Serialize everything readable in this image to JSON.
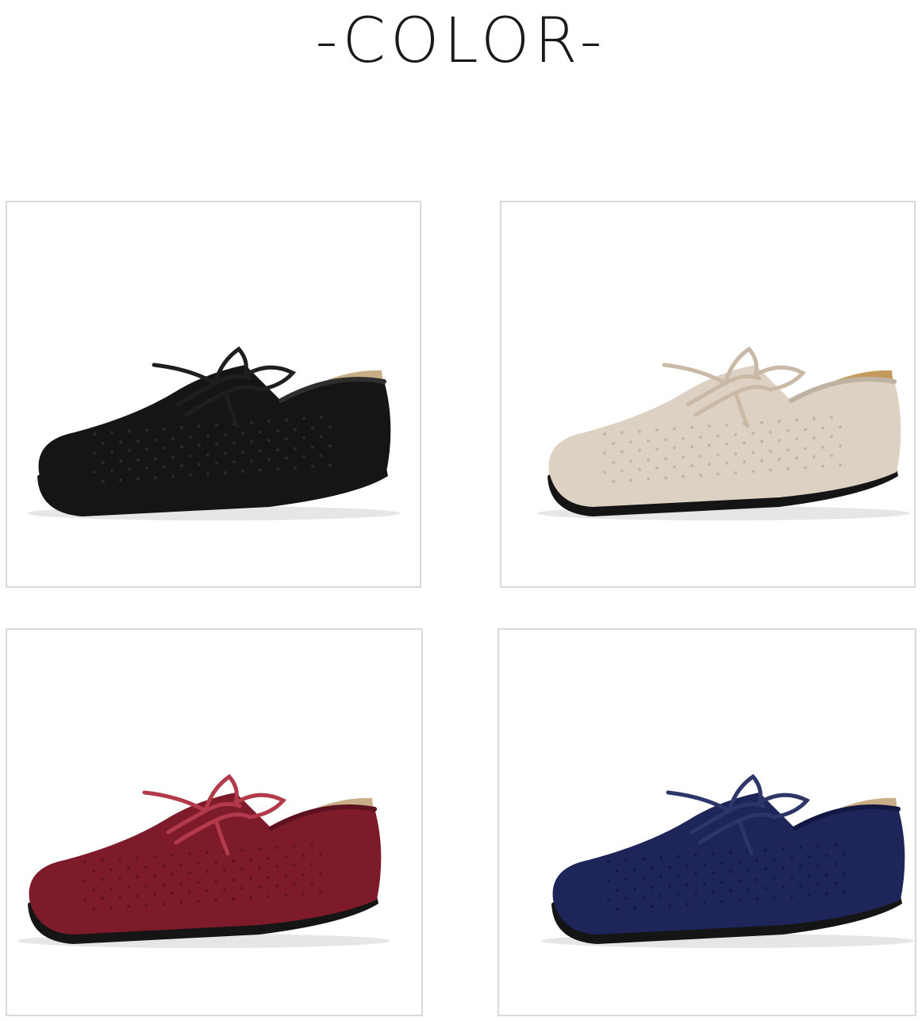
{
  "header": {
    "title": "-COLOR-"
  },
  "variants": [
    {
      "color": "#151515",
      "lace": "#1f1f1f",
      "insole": "#c9ad86",
      "pattern": "#2e2e2e"
    },
    {
      "color": "#ddd1c3",
      "lace": "#c9b9a6",
      "insole": "#c59a5e",
      "pattern": "#bfb2a2"
    },
    {
      "color": "#7d1b2a",
      "lace": "#b23a4a",
      "insole": "#c9ad86",
      "pattern": "#5e1220"
    },
    {
      "color": "#1e2559",
      "lace": "#2c3668",
      "insole": "#c9ad86",
      "pattern": "#121842"
    }
  ]
}
